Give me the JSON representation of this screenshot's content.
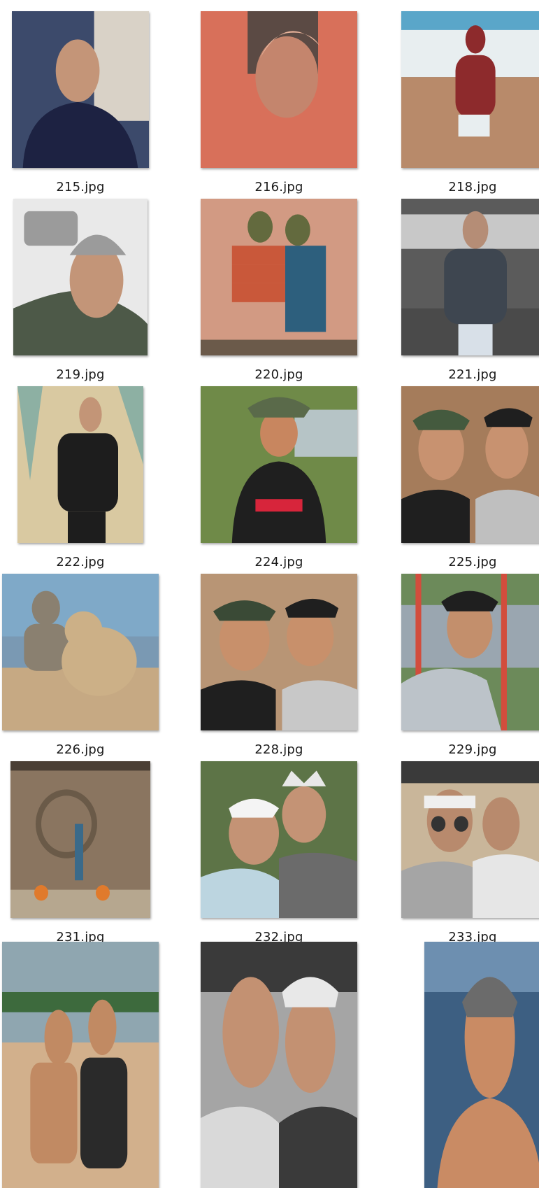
{
  "files": [
    {
      "name": "215.jpg",
      "tone": [
        "#3c4a6b",
        "#d9d2c7",
        "#1d2242",
        "#c49578"
      ]
    },
    {
      "name": "216.jpg",
      "tone": [
        "#d8705a",
        "#5b4a44",
        "#e8b39b",
        "#c4856d"
      ]
    },
    {
      "name": "218.jpg",
      "tone": [
        "#5aa6c9",
        "#e8eef0",
        "#b88a6a",
        "#8d2a2c"
      ]
    },
    {
      "name": "219.jpg",
      "tone": [
        "#e9e9e9",
        "#9b9b9b",
        "#4d5948",
        "#c39578"
      ]
    },
    {
      "name": "220.jpg",
      "tone": [
        "#d29a83",
        "#c9583a",
        "#2d5f7d",
        "#636a3e"
      ]
    },
    {
      "name": "221.jpg",
      "tone": [
        "#5b5b5b",
        "#c8c8c8",
        "#3e4650",
        "#b58d76"
      ]
    },
    {
      "name": "222.jpg",
      "tone": [
        "#d9c9a1",
        "#8db0a3",
        "#1d1d1d",
        "#c39577"
      ]
    },
    {
      "name": "224.jpg",
      "tone": [
        "#6f8a48",
        "#b6c4c6",
        "#1f1f1f",
        "#c8865f"
      ]
    },
    {
      "name": "225.jpg",
      "tone": [
        "#a57c5b",
        "#445a3e",
        "#1f1f1f",
        "#c89270"
      ]
    },
    {
      "name": "226.jpg",
      "tone": [
        "#7fa9c8",
        "#c6a983",
        "#ccb087",
        "#8a8070"
      ]
    },
    {
      "name": "228.jpg",
      "tone": [
        "#b89575",
        "#3a4a36",
        "#1f1f1f",
        "#c8906b"
      ]
    },
    {
      "name": "229.jpg",
      "tone": [
        "#6c8a5a",
        "#9aa6b0",
        "#d24d3d",
        "#c38f6c"
      ]
    },
    {
      "name": "231.jpg",
      "tone": [
        "#8a7560",
        "#b6a78f",
        "#e07a2c",
        "#5a4a3b"
      ]
    },
    {
      "name": "232.jpg",
      "tone": [
        "#5d7447",
        "#bcd5e0",
        "#6b6b6b",
        "#c49375"
      ]
    },
    {
      "name": "233.jpg",
      "tone": [
        "#c9b69a",
        "#a5a5a5",
        "#e6e6e6",
        "#b88a6d"
      ]
    },
    {
      "name": "",
      "tone": [
        "#d2b08c",
        "#8fa6b0",
        "#2a2a2a",
        "#c18a63"
      ]
    },
    {
      "name": "",
      "tone": [
        "#a5a5a5",
        "#3a3a3a",
        "#e8e8e8",
        "#c39172"
      ]
    },
    {
      "name": "",
      "tone": [
        "#6d8fb0",
        "#3d5f82",
        "#6b6b6b",
        "#c98b64"
      ]
    }
  ]
}
